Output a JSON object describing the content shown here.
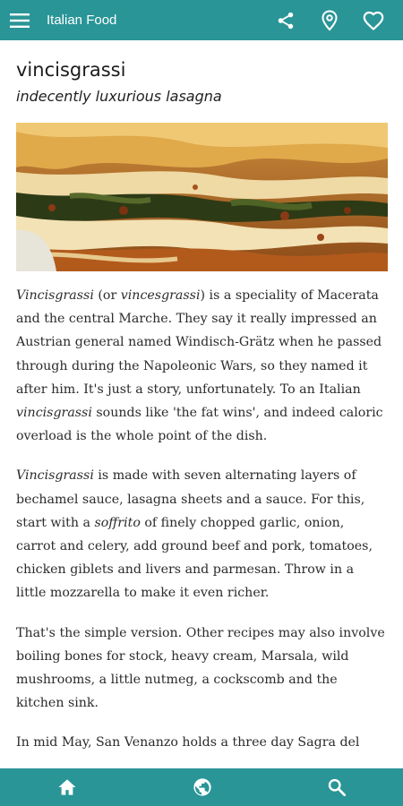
{
  "appbar": {
    "title": "Italian Food",
    "icons": [
      "menu-icon",
      "share-icon",
      "location-icon",
      "heart-icon"
    ]
  },
  "article": {
    "title": "vincisgrassi",
    "subtitle": "indecently luxurious lasagna",
    "image_alt": "lasagna",
    "paragraphs": [
      {
        "em1": "Vincisgrassi",
        "t1": " (or ",
        "em2": "vincesgrassi",
        "t2": ") is a speciality of Macerata and the central Marche. They say it really impressed an Austrian general named Windisch-Grätz when he passed through during the Napoleonic Wars, so they named it after him. It's just a story, unfortunately. To an Italian ",
        "em3": "vincisgrassi",
        "t3": " sounds like 'the fat wins', and indeed caloric overload is the whole point of the dish."
      },
      {
        "em1": "Vincisgrassi",
        "t1": " is made with seven alternating layers of bechamel sauce, lasagna sheets and a sauce. For this, start with a ",
        "em2": "soffrito",
        "t2": " of finely chopped garlic, onion, carrot and celery, add ground beef and pork, tomatoes, chicken giblets and livers and parmesan. Throw in a little mozzarella to make it even richer."
      },
      {
        "text": "That's the simple version. Other recipes may also involve boiling bones for stock, heavy cream, Marsala, wild mushrooms, a little nutmeg, a cockscomb and the kitchen sink."
      },
      {
        "text": "In mid May, San Venanzo holds a three day Sagra del"
      }
    ]
  },
  "bottom_nav": {
    "icons": [
      "home-icon",
      "globe-icon",
      "search-icon"
    ]
  },
  "colors": {
    "primary": "#2a9597",
    "text": "#2b2b2b",
    "on_primary": "#ffffff"
  }
}
